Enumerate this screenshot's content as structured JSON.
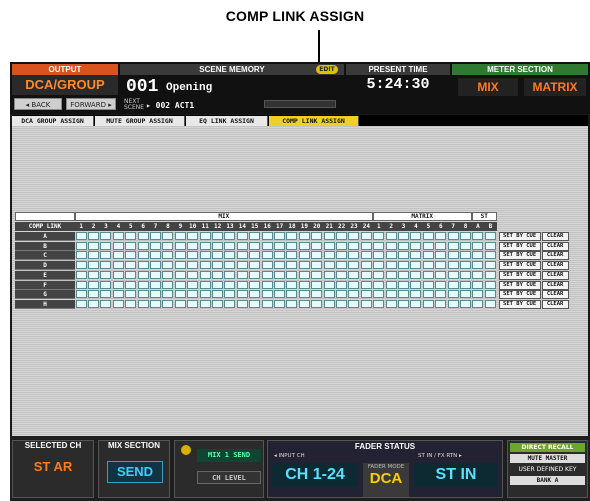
{
  "callout": {
    "title": "COMP LINK ASSIGN"
  },
  "header": {
    "output": {
      "label": "OUTPUT",
      "value": "DCA/GROUP",
      "back": "◂ BACK",
      "forward": "FORWARD ▸"
    },
    "scene_memory": {
      "label": "SCENE MEMORY",
      "edit": "EDIT",
      "number": "001",
      "name": "Opening",
      "next_label": "NEXT SCENE",
      "next_value": "▸ 002 ACT1"
    },
    "present_time": {
      "label": "PRESENT TIME",
      "value": "5:24:30"
    },
    "meter_section": {
      "label": "METER SECTION",
      "mix": "MIX",
      "matrix": "MATRIX"
    }
  },
  "tabs": [
    {
      "label": "DCA GROUP ASSIGN"
    },
    {
      "label": "MUTE GROUP ASSIGN"
    },
    {
      "label": "EQ LINK ASSIGN"
    },
    {
      "label": "COMP LINK ASSIGN"
    }
  ],
  "grid": {
    "header_mix": "MIX",
    "header_matrix": "MATRIX",
    "header_st": "ST",
    "corner_label": "COMP LINK",
    "mix_columns": [
      "1",
      "2",
      "3",
      "4",
      "5",
      "6",
      "7",
      "8",
      "9",
      "10",
      "11",
      "12",
      "13",
      "14",
      "15",
      "16",
      "17",
      "18",
      "19",
      "20",
      "21",
      "22",
      "23",
      "24"
    ],
    "matrix_columns": [
      "1",
      "2",
      "3",
      "4",
      "5",
      "6",
      "7",
      "8"
    ],
    "st_columns": [
      "A",
      "B"
    ],
    "rows": [
      {
        "label": "A"
      },
      {
        "label": "B"
      },
      {
        "label": "C"
      },
      {
        "label": "D"
      },
      {
        "label": "E"
      },
      {
        "label": "F"
      },
      {
        "label": "G"
      },
      {
        "label": "H"
      }
    ],
    "set_by_cue": "SET BY CUE",
    "clear": "CLEAR"
  },
  "footer": {
    "selected_ch": {
      "label": "SELECTED CH",
      "value": "ST AR"
    },
    "mix_section": {
      "label": "MIX SECTION",
      "value": "SEND"
    },
    "mix_send": "MIX 1 SEND",
    "ch_level": "CH LEVEL",
    "fader_status": {
      "label": "FADER STATUS",
      "input_ch_label": "◂ INPUT CH",
      "input_ch": "CH 1-24",
      "fader_mode_label": "FADER MODE",
      "fader_mode": "DCA",
      "st_label": "ST IN / FX RTN ▸",
      "st": "ST IN"
    },
    "direct_recall": {
      "label": "DIRECT RECALL",
      "mute_master": "MUTE MASTER",
      "user_keys": "USER DEFINED KEY",
      "bank": "BANK A"
    }
  }
}
